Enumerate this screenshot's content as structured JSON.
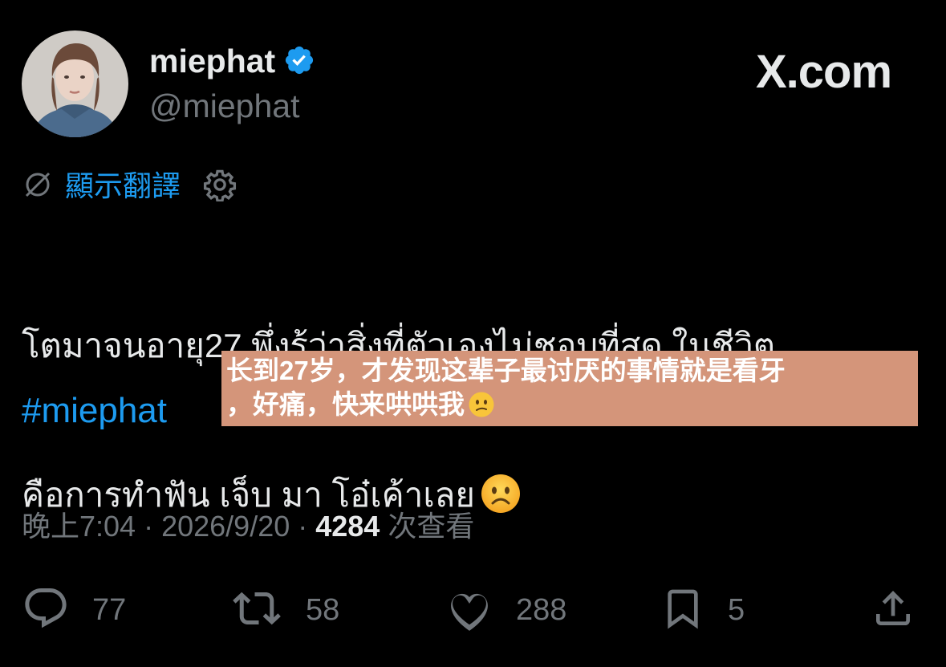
{
  "author": {
    "display_name": "miephat",
    "handle": "@miephat",
    "verified": true,
    "verified_color": "#1d9bf0"
  },
  "brand": {
    "label": "X.com"
  },
  "translate": {
    "label": "顯示翻譯",
    "icon": "no-translate-icon",
    "settings_icon": "gear-icon"
  },
  "tweet": {
    "text_line1": "โตมาจนอายุ27 พึ่งรู้ว่าสิ่งที่ตัวเองไม่ชอบที่สุด ในชีวิต",
    "text_line2": "คือการทำฟัน เจ็บ มา โอ๋เค้าเลย",
    "emoji": "frowning-face",
    "hashtag": "#miephat"
  },
  "overlay": {
    "line1": "长到27岁，才发现这辈子最讨厌的事情就是看牙",
    "line2": "，好痛，快来哄哄我",
    "emoji": "confused-face",
    "background": "#d4957a"
  },
  "meta": {
    "time": "晚上7:04",
    "sep1": " · ",
    "date": "2026/9/20",
    "sep2": " · ",
    "views": "4284",
    "views_label": " 次查看"
  },
  "actions": {
    "replies": "77",
    "reposts": "58",
    "likes": "288",
    "bookmarks": "5"
  },
  "colors": {
    "background": "#000000",
    "text": "#e7e9ea",
    "muted": "#71767b",
    "link": "#1d9bf0"
  }
}
